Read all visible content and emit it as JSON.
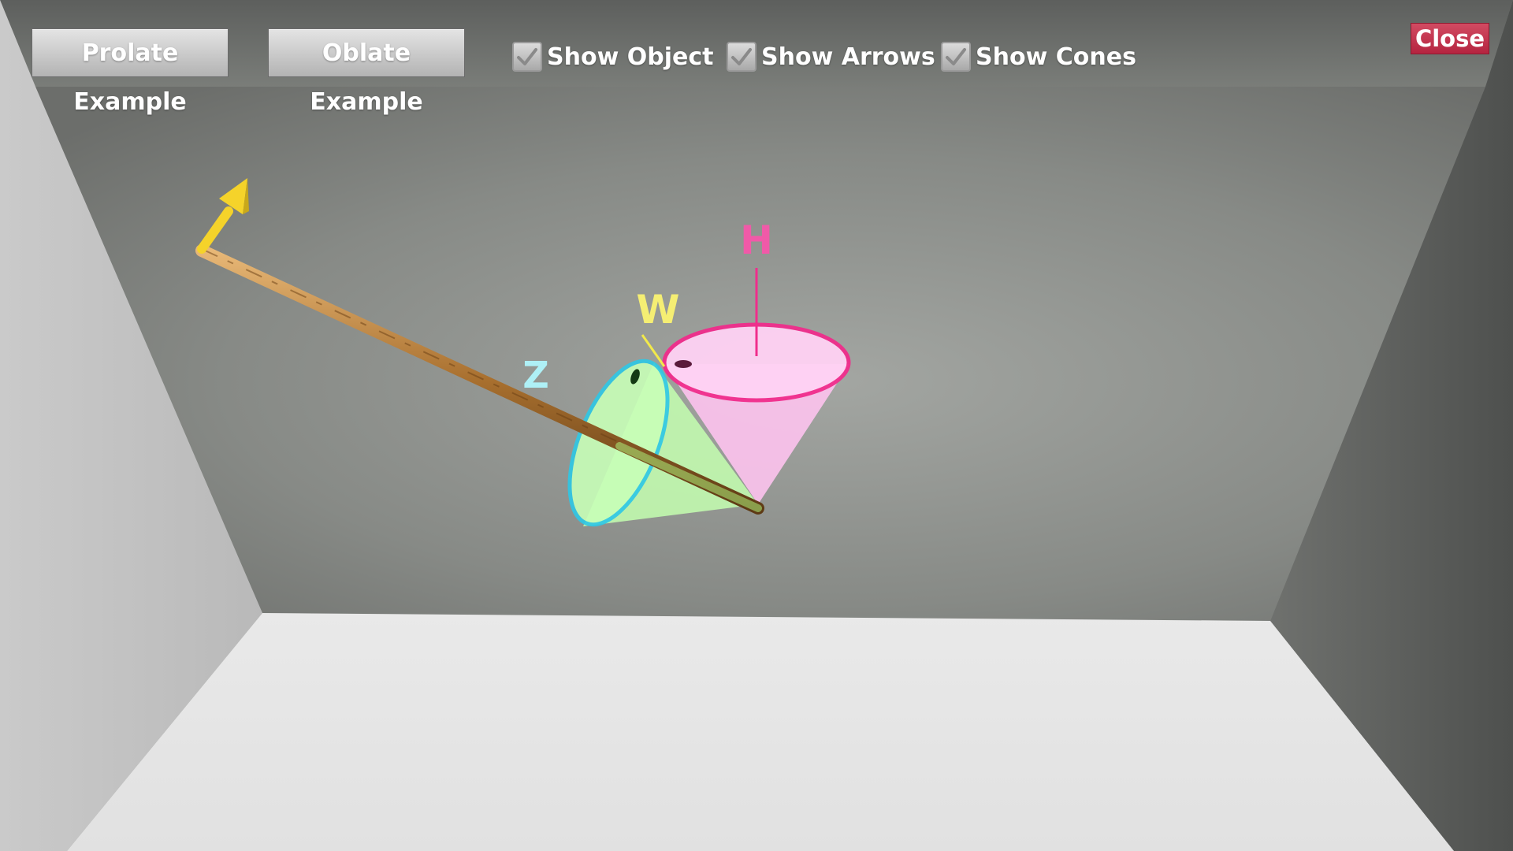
{
  "toolbar": {
    "prolate_label": "Prolate Example",
    "oblate_label": "Oblate Example",
    "close_label": "Close"
  },
  "toggles": {
    "show_object": {
      "label": "Show Object",
      "checked": true
    },
    "show_arrows": {
      "label": "Show Arrows",
      "checked": true
    },
    "show_cones": {
      "label": "Show Cones",
      "checked": true
    }
  },
  "scene": {
    "axis_labels": {
      "h": "H",
      "w": "W",
      "z": "Z"
    },
    "colors": {
      "h_axis": "#f02d8c",
      "w_axis": "#f2e94a",
      "z_axis": "#7fe6f0",
      "h_cone_fill": "#ffc4f0",
      "z_cone_fill": "#c4ffb0",
      "arrow": "#f5d32a",
      "rod": "#b07a3e",
      "close_button": "#c33150"
    }
  }
}
